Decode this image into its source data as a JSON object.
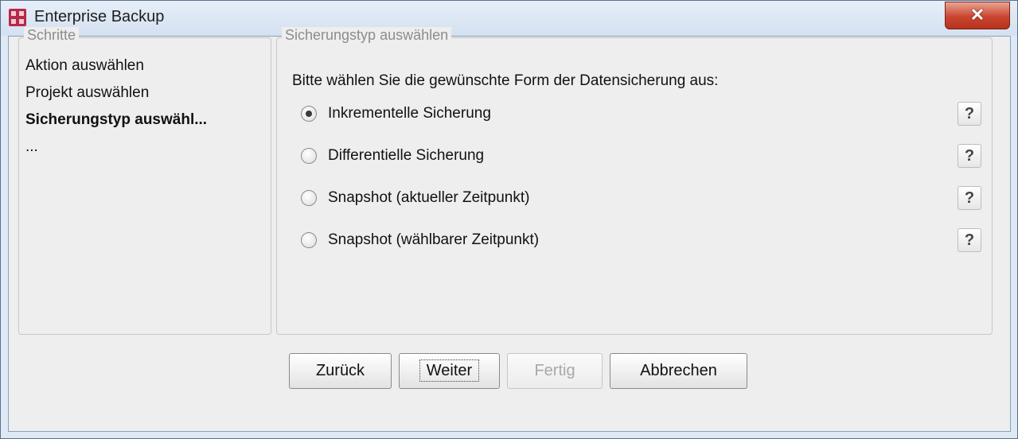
{
  "window": {
    "title": "Enterprise Backup",
    "close_glyph": "✕"
  },
  "steps": {
    "legend": "Schritte",
    "items": [
      {
        "label": "Aktion auswählen",
        "active": false
      },
      {
        "label": "Projekt auswählen",
        "active": false
      },
      {
        "label": "Sicherungstyp auswähl...",
        "active": true
      },
      {
        "label": "...",
        "active": false
      }
    ]
  },
  "panel": {
    "legend": "Sicherungstyp auswählen",
    "prompt": "Bitte wählen Sie die gewünschte Form der Datensicherung aus:",
    "options": [
      {
        "label": "Inkrementelle Sicherung",
        "selected": true,
        "help": "?"
      },
      {
        "label": "Differentielle Sicherung",
        "selected": false,
        "help": "?"
      },
      {
        "label": "Snapshot (aktueller Zeitpunkt)",
        "selected": false,
        "help": "?"
      },
      {
        "label": "Snapshot (wählbarer Zeitpunkt)",
        "selected": false,
        "help": "?"
      }
    ]
  },
  "buttons": {
    "back": "Zurück",
    "next": "Weiter",
    "finish": "Fertig",
    "cancel": "Abbrechen"
  },
  "icons": {
    "app": "enterprise-backup-icon",
    "close": "close-icon",
    "help": "help-icon"
  }
}
